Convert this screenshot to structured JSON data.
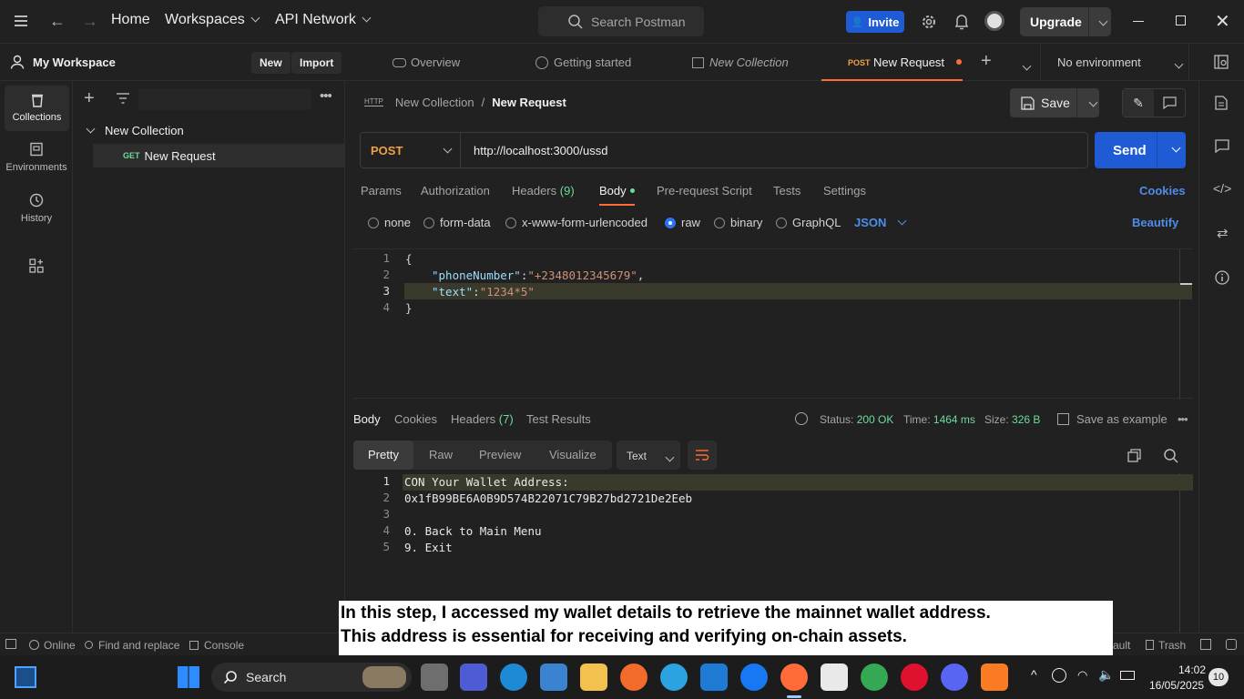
{
  "titlebar": {
    "home": "Home",
    "workspaces": "Workspaces",
    "api_network": "API Network",
    "search_placeholder": "Search Postman",
    "invite": "Invite",
    "upgrade": "Upgrade"
  },
  "workspace": {
    "name": "My Workspace",
    "new": "New",
    "import": "Import"
  },
  "sidebar": {
    "items": [
      {
        "label": "Collections",
        "icon": "trash-can-icon"
      },
      {
        "label": "Environments",
        "icon": "environment-icon"
      },
      {
        "label": "History",
        "icon": "history-icon"
      }
    ]
  },
  "collection": {
    "name": "New Collection",
    "request_method": "GET",
    "request_name": "New Request"
  },
  "tabs": [
    {
      "label": "Overview"
    },
    {
      "label": "Getting started"
    },
    {
      "label": "New Collection"
    },
    {
      "method": "POST",
      "label": "New Request"
    }
  ],
  "environment": "No environment",
  "breadcrumb": {
    "collection": "New Collection",
    "sep": "/",
    "request": "New Request"
  },
  "save": "Save",
  "request": {
    "method": "POST",
    "url": "http://localhost:3000/ussd",
    "send": "Send"
  },
  "req_tabs": {
    "params": "Params",
    "authorization": "Authorization",
    "headers": "Headers",
    "headers_count": "(9)",
    "body": "Body",
    "prerequest": "Pre-request Script",
    "tests": "Tests",
    "settings": "Settings",
    "cookies": "Cookies"
  },
  "body_types": {
    "none": "none",
    "form_data": "form-data",
    "urlencoded": "x-www-form-urlencoded",
    "raw": "raw",
    "binary": "binary",
    "graphql": "GraphQL",
    "json": "JSON",
    "beautify": "Beautify"
  },
  "request_body": [
    {
      "n": "1",
      "text": "{"
    },
    {
      "n": "2",
      "key": "\"phoneNumber\"",
      "value": "\"+2348012345679\"",
      "trail": ","
    },
    {
      "n": "3",
      "key": "\"text\"",
      "value": "\"1234*5\"",
      "trail": ""
    },
    {
      "n": "4",
      "text": "}"
    }
  ],
  "response": {
    "tabs": {
      "body": "Body",
      "cookies": "Cookies",
      "headers": "Headers",
      "headers_count": "(7)",
      "test_results": "Test Results"
    },
    "status_label": "Status:",
    "status": "200 OK",
    "time_label": "Time:",
    "time": "1464 ms",
    "size_label": "Size:",
    "size": "326 B",
    "save_example": "Save as example",
    "view_tabs": {
      "pretty": "Pretty",
      "raw": "Raw",
      "preview": "Preview",
      "visualize": "Visualize",
      "format": "Text"
    },
    "lines": [
      {
        "n": "1",
        "text": "CON Your Wallet Address:"
      },
      {
        "n": "2",
        "text": "0x1fB99BE6A0B9D574B22071C79B27bd2721De2Eeb"
      },
      {
        "n": "3",
        "text": ""
      },
      {
        "n": "4",
        "text": "0. Back to Main Menu"
      },
      {
        "n": "5",
        "text": "9. Exit"
      }
    ]
  },
  "statusbar": {
    "online": "Online",
    "find_replace": "Find and replace",
    "console": "Console",
    "default_partial": "ault",
    "trash": "Trash"
  },
  "caption": {
    "line1": "In this step, I accessed my wallet details to retrieve the mainnet wallet address.",
    "line2": "This address is essential for receiving and verifying on-chain assets."
  },
  "taskbar": {
    "search": "Search",
    "time": "14:02",
    "date": "16/05/2025",
    "badge": "10"
  },
  "colors": {
    "accent_blue": "#1f5bd5",
    "post_orange": "#f0a04b",
    "get_green": "#6bdd9a",
    "status_green": "#6bdd9a",
    "tab_active": "#ff6c37"
  }
}
